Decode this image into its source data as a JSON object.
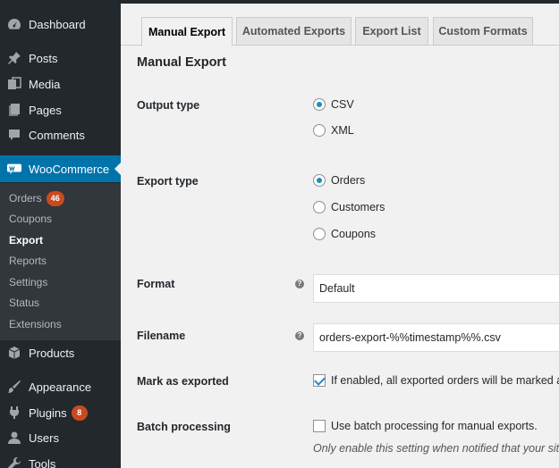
{
  "sidebar": {
    "dashboard": "Dashboard",
    "posts": "Posts",
    "media": "Media",
    "pages": "Pages",
    "comments": "Comments",
    "woocommerce": "WooCommerce",
    "products": "Products",
    "appearance": "Appearance",
    "plugins": "Plugins",
    "plugins_badge": "8",
    "users": "Users",
    "tools": "Tools",
    "submenu": {
      "orders": "Orders",
      "orders_badge": "46",
      "coupons": "Coupons",
      "export": "Export",
      "reports": "Reports",
      "settings": "Settings",
      "status": "Status",
      "extensions": "Extensions"
    },
    "accent_color": "#0073aa"
  },
  "tabs": {
    "manual": "Manual Export",
    "automated": "Automated Exports",
    "list": "Export List",
    "custom": "Custom Formats"
  },
  "page": {
    "heading": "Manual Export",
    "output_type": {
      "label": "Output type",
      "options": [
        "CSV",
        "XML"
      ],
      "selected": "CSV"
    },
    "export_type": {
      "label": "Export type",
      "options": [
        "Orders",
        "Customers",
        "Coupons"
      ],
      "selected": "Orders"
    },
    "format": {
      "label": "Format",
      "value": "Default"
    },
    "filename": {
      "label": "Filename",
      "value": "orders-export-%%timestamp%%.csv"
    },
    "mark_exported": {
      "label": "Mark as exported",
      "checked": true,
      "text": "If enabled, all exported orders will be marked as"
    },
    "batch": {
      "label": "Batch processing",
      "checked": false,
      "text": "Use batch processing for manual exports.",
      "description": "Only enable this setting when notified that your site"
    },
    "help_glyph": "?"
  }
}
